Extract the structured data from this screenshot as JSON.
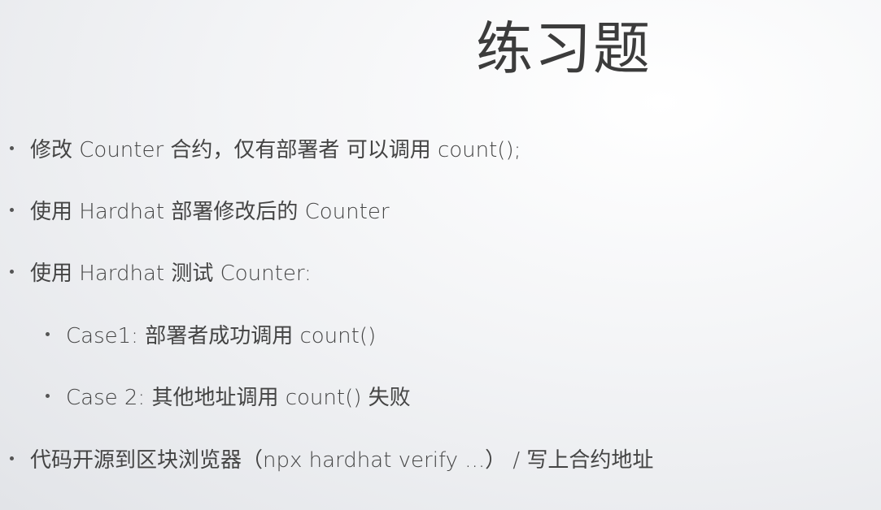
{
  "slide": {
    "title": "练习题",
    "bullets": [
      {
        "text": "修改 Counter 合约，仅有部署者 可以调用 count();"
      },
      {
        "text": "使用 Hardhat 部署修改后的 Counter"
      },
      {
        "text": "使用 Hardhat 测试 Counter:"
      },
      {
        "text": "Case1:  部署者成功调用 count()"
      },
      {
        "text": "Case 2:  其他地址调用 count() 失败"
      },
      {
        "text": "代码开源到区块浏览器（npx hardhat verify ...） / 写上合约地址"
      }
    ]
  }
}
